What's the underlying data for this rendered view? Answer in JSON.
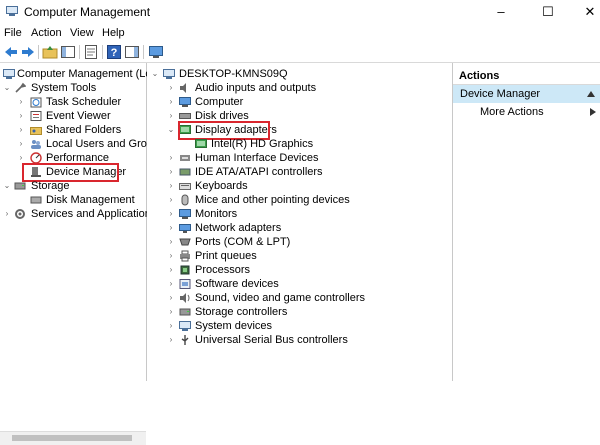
{
  "window": {
    "title": "Computer Management",
    "controls": [
      "–",
      "☐",
      "✕"
    ]
  },
  "menu": [
    "File",
    "Action",
    "View",
    "Help"
  ],
  "left_tree": [
    {
      "label": "Computer Management (Local",
      "icon": "computer-management-icon"
    },
    {
      "label": "System Tools",
      "icon": "tools-icon"
    },
    {
      "label": "Task Scheduler",
      "icon": "clock-icon"
    },
    {
      "label": "Event Viewer",
      "icon": "event-viewer-icon"
    },
    {
      "label": "Shared Folders",
      "icon": "shared-folder-icon"
    },
    {
      "label": "Local Users and Groups",
      "icon": "users-icon"
    },
    {
      "label": "Performance",
      "icon": "performance-icon"
    },
    {
      "label": "Device Manager",
      "icon": "device-manager-icon"
    },
    {
      "label": "Storage",
      "icon": "storage-icon"
    },
    {
      "label": "Disk Management",
      "icon": "disk-icon"
    },
    {
      "label": "Services and Applications",
      "icon": "services-icon"
    }
  ],
  "device_tree": {
    "root": "DESKTOP-KMNS09Q",
    "items": [
      "Audio inputs and outputs",
      "Computer",
      "Disk drives",
      "Display adapters",
      "Intel(R) HD Graphics",
      "Human Interface Devices",
      "IDE ATA/ATAPI controllers",
      "Keyboards",
      "Mice and other pointing devices",
      "Monitors",
      "Network adapters",
      "Ports (COM & LPT)",
      "Print queues",
      "Processors",
      "Software devices",
      "Sound, video and game controllers",
      "Storage controllers",
      "System devices",
      "Universal Serial Bus controllers"
    ]
  },
  "actions": {
    "header": "Actions",
    "section": "Device Manager",
    "more": "More Actions"
  },
  "colors": {
    "highlight": "#d9262e",
    "selection": "#cde8f7"
  }
}
